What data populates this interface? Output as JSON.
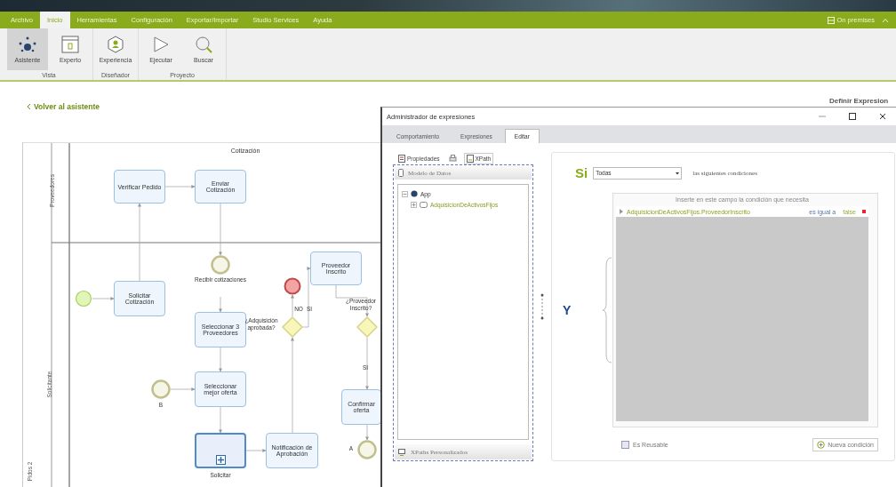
{
  "menu": {
    "tabs": [
      {
        "label": "Archivo",
        "selected": false
      },
      {
        "label": "Inicio",
        "selected": true
      },
      {
        "label": "Herramientas",
        "selected": false
      },
      {
        "label": "Configuración",
        "selected": false
      },
      {
        "label": "Exportar/Importar",
        "selected": false
      },
      {
        "label": "Studio Services",
        "selected": false
      },
      {
        "label": "Ayuda",
        "selected": false
      }
    ],
    "environment": "On premises"
  },
  "ribbon": {
    "groups": [
      {
        "label": "Vista",
        "buttons": [
          {
            "label": "Asistente",
            "selected": true
          },
          {
            "label": "Experto",
            "selected": false
          }
        ]
      },
      {
        "label": "Diseñador",
        "buttons": [
          {
            "label": "Experiencia",
            "selected": false
          }
        ]
      },
      {
        "label": "Proyecto",
        "buttons": [
          {
            "label": "Ejecutar",
            "selected": false
          },
          {
            "label": "Buscar",
            "selected": false
          }
        ]
      }
    ]
  },
  "back_link": "Volver al asistente",
  "page_title": "Definir Expresion",
  "diagram": {
    "pool_label": "Pidos 2",
    "title": "Cotización",
    "lanes": [
      {
        "label": "Proveedores"
      },
      {
        "label": "Solicitante"
      }
    ],
    "nodes": [
      {
        "kind": "task",
        "text": "Verificar Pedido"
      },
      {
        "kind": "task",
        "text": "Enviar Cotización"
      },
      {
        "kind": "start"
      },
      {
        "kind": "task",
        "text": "Solicitar Cotización"
      },
      {
        "kind": "intermediate",
        "label": "Recibir cotizaciones"
      },
      {
        "kind": "task",
        "text": "Seleccionar 3 Proveedores"
      },
      {
        "kind": "gateway",
        "label": "¿Adquisición aprobada?"
      },
      {
        "kind": "end"
      },
      {
        "kind": "task",
        "text": "Proveedor Inscrito"
      },
      {
        "kind": "gateway",
        "label": "¿Proveedor Inscrito?"
      },
      {
        "kind": "task",
        "text": "Confirmar oferta"
      },
      {
        "kind": "intermediate",
        "label": "A"
      },
      {
        "kind": "intermediate",
        "label": "B"
      },
      {
        "kind": "task",
        "text": "Seleccionar mejor oferta"
      },
      {
        "kind": "subprocess",
        "label": "Solicitar"
      },
      {
        "kind": "task",
        "text": "Notificación de Aprobación"
      },
      {
        "kind": "flow-label",
        "text": "NO"
      },
      {
        "kind": "flow-label",
        "text": "SI"
      },
      {
        "kind": "flow-label",
        "text": "SI"
      }
    ]
  },
  "dialog": {
    "title": "Administrador de expresiones",
    "tabs": [
      {
        "label": "Comportamiento",
        "selected": false
      },
      {
        "label": "Expresiones",
        "selected": false
      },
      {
        "label": "Editar",
        "selected": true
      }
    ],
    "toolbar": {
      "properties": "Propiedades",
      "xpath": "XPath"
    },
    "model_header": "Modelo de Datos",
    "tree": [
      {
        "label": "App",
        "expanded": true,
        "children": [
          {
            "label": "AdquisicionDeActivosFijos",
            "expanded": false
          }
        ]
      }
    ],
    "footer": "XPaths Personalizados",
    "condition": {
      "prefix": "Si",
      "match": "Todas",
      "suffix": "las siguientes condiciones",
      "operator": "Y",
      "hint": "Inserte en este campo la condición que necesita",
      "rows": [
        {
          "field": "AdquisicionDeActivosFijos.ProveedorInscrito",
          "operator": "es igual a",
          "value": "false"
        }
      ],
      "reusable": {
        "label": "Es Reusable",
        "checked": false
      },
      "add_button": "Nueva condición"
    }
  }
}
